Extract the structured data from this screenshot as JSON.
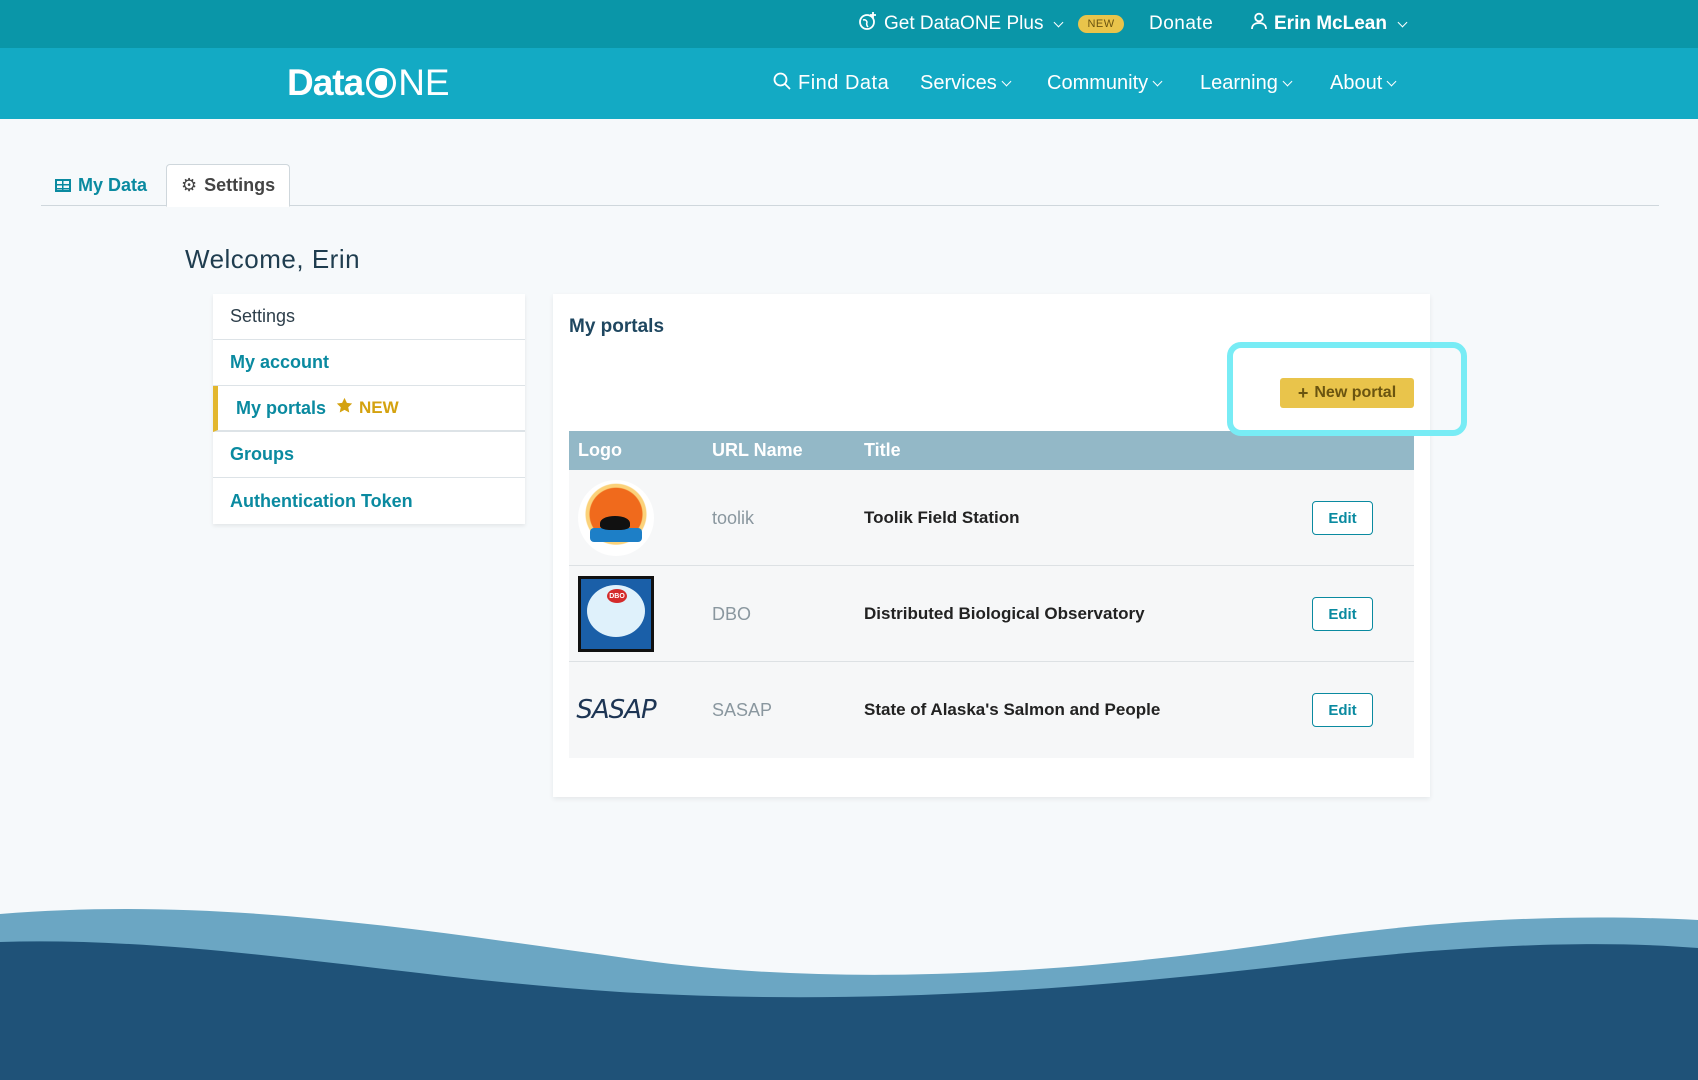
{
  "topbar": {
    "plus_label": "Get DataONE Plus",
    "plus_badge": "NEW",
    "donate": "Donate",
    "user": "Erin McLean"
  },
  "navbar": {
    "logo_text_a": "Data",
    "logo_text_b": "NE",
    "items": [
      "Find Data",
      "Services",
      "Community",
      "Learning",
      "About"
    ]
  },
  "tabs": {
    "my_data": "My Data",
    "settings": "Settings"
  },
  "welcome": "Welcome, Erin",
  "sidemenu": {
    "heading": "Settings",
    "items": [
      "My account",
      "My portals",
      "Groups",
      "Authentication Token"
    ],
    "new_badge": "NEW"
  },
  "portals": {
    "title": "My portals",
    "new_button": "New portal",
    "columns": [
      "Logo",
      "URL Name",
      "Title"
    ],
    "rows": [
      {
        "url": "toolik",
        "title": "Toolik Field Station",
        "action": "Edit"
      },
      {
        "url": "DBO",
        "title": "Distributed Biological Observatory",
        "action": "Edit"
      },
      {
        "url": "SASAP",
        "title": "State of Alaska's Salmon and People",
        "action": "Edit",
        "logo_text": "SASAP"
      }
    ]
  },
  "colors": {
    "topbar": "#0a96a8",
    "navbar": "#13aac4",
    "accent_yellow": "#e9c44b",
    "link": "#0a8aa0",
    "table_header": "#93b8c7",
    "highlight": "#78ecf5",
    "wave_light": "#6ba6c3",
    "wave_dark": "#1f5278"
  }
}
